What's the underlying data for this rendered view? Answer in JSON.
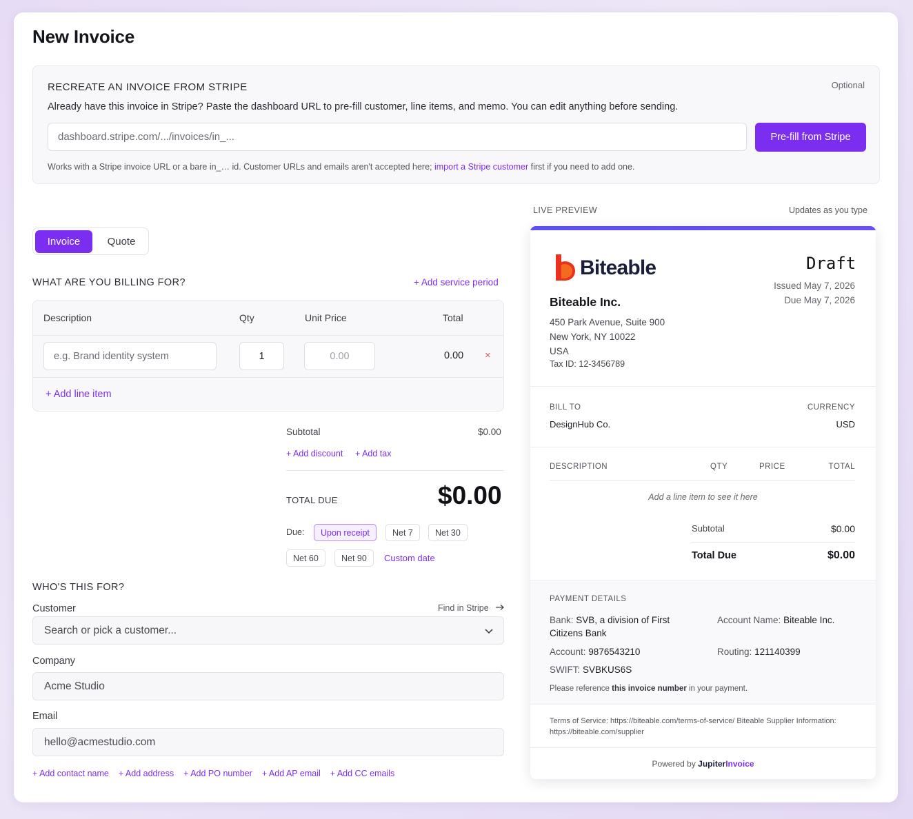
{
  "page_title": "New Invoice",
  "stripe": {
    "heading": "RECREATE AN INVOICE FROM STRIPE",
    "optional": "Optional",
    "description": "Already have this invoice in Stripe? Paste the dashboard URL to pre-fill customer, line items, and memo. You can edit anything before sending.",
    "input_placeholder": "dashboard.stripe.com/.../invoices/in_...",
    "button": "Pre-fill from Stripe",
    "note_before": "Works with a Stripe invoice URL or a bare in_… id. Customer URLs and emails aren't accepted here;",
    "note_link": "import a Stripe customer",
    "note_after": "first if you need to add one."
  },
  "doc_type": {
    "invoice": "Invoice",
    "quote": "Quote",
    "selected": "Invoice"
  },
  "billing": {
    "heading": "WHAT ARE YOU BILLING FOR?",
    "add_service_period": "+ Add service period",
    "columns": {
      "description": "Description",
      "qty": "Qty",
      "unit_price": "Unit Price",
      "total": "Total"
    },
    "row": {
      "description_placeholder": "e.g. Brand identity system",
      "qty": "1",
      "price_placeholder": "0.00",
      "total": "0.00",
      "remove": "×"
    },
    "add_line_item": "+ Add line item"
  },
  "totals": {
    "subtotal_label": "Subtotal",
    "subtotal_value": "$0.00",
    "add_discount": "+ Add discount",
    "add_tax": "+ Add tax",
    "total_due_label": "TOTAL DUE",
    "total_due_value": "$0.00",
    "due_label": "Due:",
    "terms": [
      "Upon receipt",
      "Net 7",
      "Net 30",
      "Net 60",
      "Net 90"
    ],
    "selected_term": "Upon receipt",
    "custom_date": "Custom date"
  },
  "customer": {
    "heading": "WHO'S THIS FOR?",
    "customer_label": "Customer",
    "find_in_stripe": "Find in Stripe",
    "customer_placeholder": "Search or pick a customer...",
    "company_label": "Company",
    "company_value": "Acme Studio",
    "email_label": "Email",
    "email_value": "hello@acmestudio.com",
    "add_links": [
      "+ Add contact name",
      "+ Add address",
      "+ Add PO number",
      "+ Add AP email",
      "+ Add CC emails"
    ]
  },
  "preview": {
    "label": "LIVE PREVIEW",
    "updates": "Updates as you type",
    "brand": "Biteable",
    "status": "Draft",
    "issued": "Issued May 7, 2026",
    "due": "Due May 7, 2026",
    "company": "Biteable Inc.",
    "address_1": "450 Park Avenue, Suite 900",
    "address_2": "New York, NY 10022",
    "address_3": "USA",
    "tax_id": "Tax ID: 12-3456789",
    "bill_to_label": "BILL TO",
    "bill_to": "DesignHub Co.",
    "currency_label": "CURRENCY",
    "currency": "USD",
    "columns": {
      "description": "DESCRIPTION",
      "qty": "QTY",
      "price": "PRICE",
      "total": "TOTAL"
    },
    "empty": "Add a line item to see it here",
    "subtotal_label": "Subtotal",
    "subtotal": "$0.00",
    "total_due_label": "Total Due",
    "total_due": "$0.00",
    "payment_heading": "PAYMENT DETAILS",
    "bank_key": "Bank:",
    "bank_val": "SVB, a division of First Citizens Bank",
    "acct_name_key": "Account Name:",
    "acct_name_val": "Biteable Inc.",
    "account_key": "Account:",
    "account_val": "9876543210",
    "routing_key": "Routing:",
    "routing_val": "121140399",
    "swift_key": "SWIFT:",
    "swift_val": "SVBKUS6S",
    "reference_before": "Please reference",
    "reference_bold": "this invoice number",
    "reference_after": "in your payment.",
    "terms": "Terms of Service: https://biteable.com/terms-of-service/ Biteable Supplier Information: https://biteable.com/supplier",
    "powered_by": "Powered by",
    "powered_brand_1": "Jupiter",
    "powered_brand_2": "Invoice"
  },
  "colors": {
    "accent": "#7c2ef0",
    "preview_bar": "#5b4ff0",
    "remove": "#e25563",
    "logo_red": "#e8321e",
    "logo_orange": "#f46a1f"
  }
}
